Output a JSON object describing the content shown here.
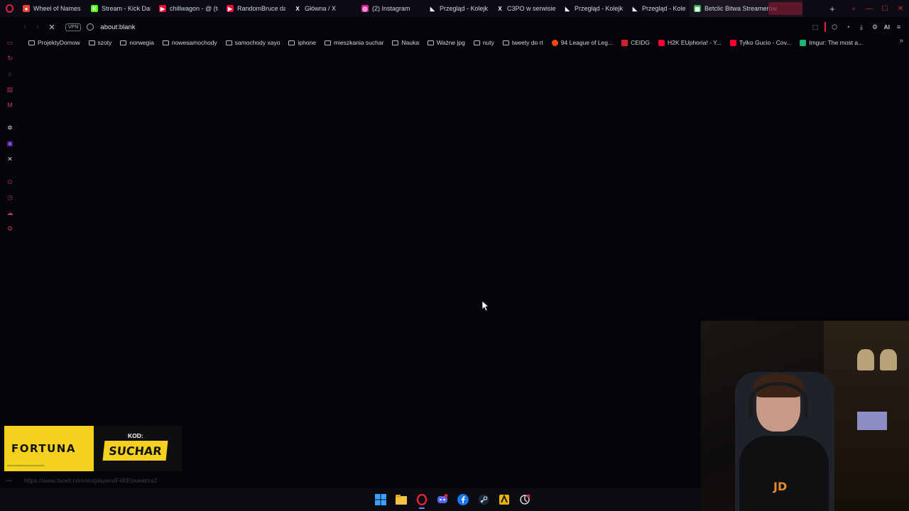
{
  "tabs": [
    {
      "label": "Wheel of Names |",
      "fav_color": "#ea4335",
      "fav_glyph": "●"
    },
    {
      "label": "Stream - Kick Dash",
      "fav_color": "#53fc18",
      "fav_glyph": "K"
    },
    {
      "label": "chillwagon - @ (tra",
      "fav_color": "#ff0033",
      "fav_glyph": "▶"
    },
    {
      "label": "RandomBruce daje",
      "fav_color": "#ff0033",
      "fav_glyph": "▶"
    },
    {
      "label": "Główna / X",
      "fav_color": "#0a0b14",
      "fav_glyph": "X"
    },
    {
      "label": "(2) Instagram",
      "fav_color": "#d6249f",
      "fav_glyph": "◎"
    },
    {
      "label": "Przegląd - Kolejka",
      "fav_color": "#0a0b14",
      "fav_glyph": "◣"
    },
    {
      "label": "C3PO w serwisie -",
      "fav_color": "#0a0b14",
      "fav_glyph": "X"
    },
    {
      "label": "Przegląd - Kolejka",
      "fav_color": "#0a0b14",
      "fav_glyph": "◣"
    },
    {
      "label": "Przegląd - Kolejka",
      "fav_color": "#0a0b14",
      "fav_glyph": "◣"
    },
    {
      "label": "Betclic Bitwa Streamerów",
      "fav_color": "#2bb34a",
      "fav_glyph": "▦"
    }
  ],
  "address": {
    "vpn_label": "VPN",
    "url": "about:blank"
  },
  "toolbar": {
    "ai_label": "AI"
  },
  "bookmarks": [
    {
      "label": "ProjektyDomow",
      "kind": "folder"
    },
    {
      "label": "szoty",
      "kind": "folder"
    },
    {
      "label": "norwegia",
      "kind": "folder"
    },
    {
      "label": "nowesamochody",
      "kind": "folder"
    },
    {
      "label": "samochody xayo",
      "kind": "folder"
    },
    {
      "label": "iphone",
      "kind": "folder"
    },
    {
      "label": "mieszkania suchar",
      "kind": "folder"
    },
    {
      "label": "Nauka",
      "kind": "folder"
    },
    {
      "label": "Ważne jpg",
      "kind": "folder"
    },
    {
      "label": "nuty",
      "kind": "folder"
    },
    {
      "label": "tweety do rt",
      "kind": "folder"
    },
    {
      "label": "94 League of Leg...",
      "kind": "site",
      "color": "#ff4500"
    },
    {
      "label": "CEIDG",
      "kind": "site",
      "color": "#d02030"
    },
    {
      "label": "H2K EUphoria! - Y...",
      "kind": "site",
      "color": "#ff0033"
    },
    {
      "label": "Tylko Gucio - Cov...",
      "kind": "site",
      "color": "#ff0033"
    },
    {
      "label": "Imgur: The most a...",
      "kind": "site",
      "color": "#1bb76e"
    }
  ],
  "promo": {
    "brand": "FORTUNA",
    "kod_label": "KOD:",
    "code": "SUCHAR"
  },
  "status_url": "https://www.faceit.com/en/players/F4KEsweet/cs2",
  "webcam": {
    "shirt_logo": "JD"
  },
  "colors": {
    "accent": "#e0243a",
    "promo_yellow": "#f4d11e",
    "background": "#04050b"
  }
}
